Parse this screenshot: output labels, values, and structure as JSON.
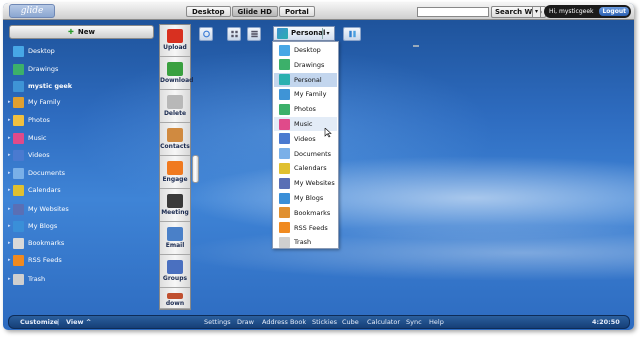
{
  "app": {
    "logo_text": "glide"
  },
  "top_tabs": [
    {
      "label": "Desktop",
      "active": false
    },
    {
      "label": "Glide HD",
      "active": true
    },
    {
      "label": "Portal",
      "active": false
    }
  ],
  "search": {
    "value": "",
    "button_label": "Search Web"
  },
  "user": {
    "greeting": "Hi, mysticgeek",
    "logout_label": "Logout"
  },
  "sidebar": {
    "new_label": "New",
    "items": [
      {
        "label": "Desktop",
        "icon": "desktop-icon",
        "color": "#47a7e6"
      },
      {
        "label": "Drawings",
        "icon": "drawings-icon",
        "color": "#3cb06a"
      },
      {
        "label": "mystic geek",
        "icon": "user-icon",
        "color": "#3f94d6",
        "bold": true
      },
      {
        "label": "My Family",
        "icon": "family-icon",
        "color": "#e0a030"
      },
      {
        "label": "Photos",
        "icon": "photos-icon",
        "color": "#f0c040"
      },
      {
        "label": "Music",
        "icon": "music-icon",
        "color": "#e04a8a"
      },
      {
        "label": "Videos",
        "icon": "videos-icon",
        "color": "#4a7ad0"
      },
      {
        "label": "Documents",
        "icon": "documents-icon",
        "color": "#7ab0e8"
      },
      {
        "label": "Calendars",
        "icon": "calendars-icon",
        "color": "#e0c030"
      },
      {
        "label": "My Websites",
        "icon": "websites-icon",
        "color": "#5a6fb5"
      },
      {
        "label": "My Blogs",
        "icon": "blogs-icon",
        "color": "#3a8fd8"
      },
      {
        "label": "Bookmarks",
        "icon": "bookmarks-icon",
        "color": "#d9d9d9"
      },
      {
        "label": "RSS Feeds",
        "icon": "rss-icon",
        "color": "#f08a20"
      },
      {
        "label": "Trash",
        "icon": "trash-icon",
        "color": "#cfcfcf"
      }
    ]
  },
  "actions": [
    {
      "label": "Upload",
      "icon": "upload-icon",
      "color": "#d83020"
    },
    {
      "label": "Download",
      "icon": "download-icon",
      "color": "#3aa040"
    },
    {
      "label": "Delete",
      "icon": "delete-icon",
      "color": "#b8b8b8"
    },
    {
      "label": "Contacts",
      "icon": "contacts-icon",
      "color": "#d08a40"
    },
    {
      "label": "Engage",
      "icon": "engage-icon",
      "color": "#f07a20"
    },
    {
      "label": "Meeting",
      "icon": "meeting-icon",
      "color": "#3a3a3a"
    },
    {
      "label": "Email",
      "icon": "email-icon",
      "color": "#4a80c8"
    },
    {
      "label": "Groups",
      "icon": "groups-icon",
      "color": "#4a70c0"
    },
    {
      "label": "down",
      "icon": "down-icon",
      "color": "#c05030"
    }
  ],
  "dropdown": {
    "selected": "Personal",
    "items": [
      {
        "label": "Desktop",
        "icon": "desktop-icon",
        "color": "#47a7e6"
      },
      {
        "label": "Drawings",
        "icon": "drawings-icon",
        "color": "#3cb06a"
      },
      {
        "label": "Personal",
        "icon": "personal-icon",
        "color": "#2bb0b0",
        "selected": true
      },
      {
        "label": "My Family",
        "icon": "family-icon",
        "color": "#3f94d6"
      },
      {
        "label": "Photos",
        "icon": "photos-icon",
        "color": "#3cb06a"
      },
      {
        "label": "Music",
        "icon": "music-icon",
        "color": "#e04a8a",
        "hover": true
      },
      {
        "label": "Videos",
        "icon": "videos-icon",
        "color": "#4a7ad0"
      },
      {
        "label": "Documents",
        "icon": "documents-icon",
        "color": "#7ab0e8"
      },
      {
        "label": "Calendars",
        "icon": "calendars-icon",
        "color": "#e0c030"
      },
      {
        "label": "My Websites",
        "icon": "websites-icon",
        "color": "#5a6fb5"
      },
      {
        "label": "My Blogs",
        "icon": "blogs-icon",
        "color": "#3a8fd8"
      },
      {
        "label": "Bookmarks",
        "icon": "bookmarks-icon",
        "color": "#e09030"
      },
      {
        "label": "RSS Feeds",
        "icon": "rss-icon",
        "color": "#f08a20"
      },
      {
        "label": "Trash",
        "icon": "trash-icon",
        "color": "#cfcfcf"
      }
    ]
  },
  "bottombar": {
    "customize_label": "Customize",
    "view_label": "View ^",
    "links": [
      "Settings",
      "Draw",
      "Address Book",
      "Stickies",
      "Cube",
      "Calculator",
      "Sync",
      "Help"
    ],
    "clock": "4:20:50 PM"
  }
}
